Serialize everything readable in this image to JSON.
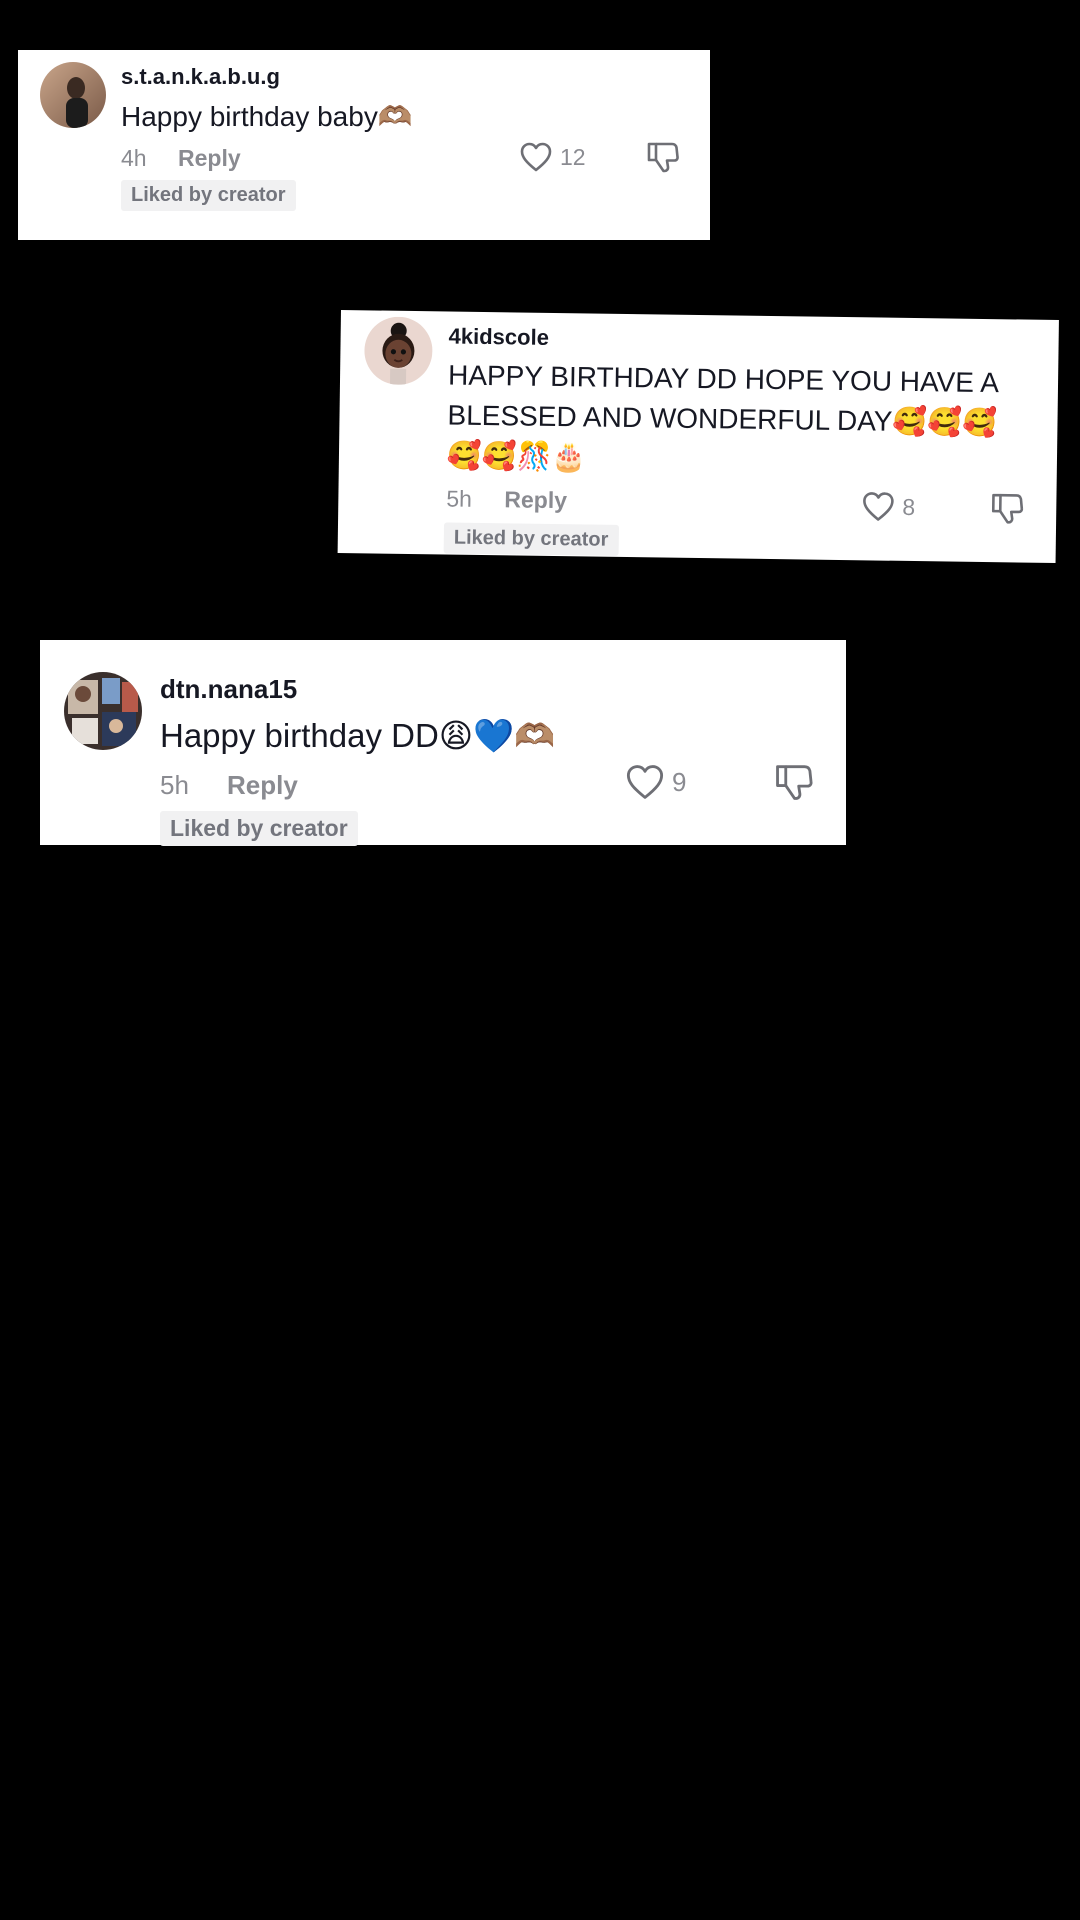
{
  "comments": [
    {
      "username": "s.t.a.n.k.a.b.u.g",
      "text": "Happy birthday baby",
      "emoji": "🫶🏽",
      "time": "4h",
      "reply_label": "Reply",
      "likes": "12",
      "badge": "Liked by creator"
    },
    {
      "username": "4kidscole",
      "text_line1": "HAPPY BIRTHDAY DD HOPE YOU HAVE A",
      "text_line2": "BLESSED AND WONDERFUL DAY",
      "emoji_line2": "🥰🥰🥰",
      "emoji_line3": "🥰🥰🎊🎂",
      "time": "5h",
      "reply_label": "Reply",
      "likes": "8",
      "badge": "Liked by creator"
    },
    {
      "username": "dtn.nana15",
      "text": "Happy birthday DD",
      "emoji": "😩💙🫶🏽",
      "time": "5h",
      "reply_label": "Reply",
      "likes": "9",
      "badge": "Liked by creator"
    }
  ],
  "colors": {
    "background": "#000000",
    "card": "#ffffff",
    "primary_text": "#161823",
    "secondary_text": "#8a8b91",
    "badge_bg": "#f1f1f2"
  },
  "icons": [
    "heart-outline-icon",
    "thumbs-down-icon",
    "avatar"
  ]
}
